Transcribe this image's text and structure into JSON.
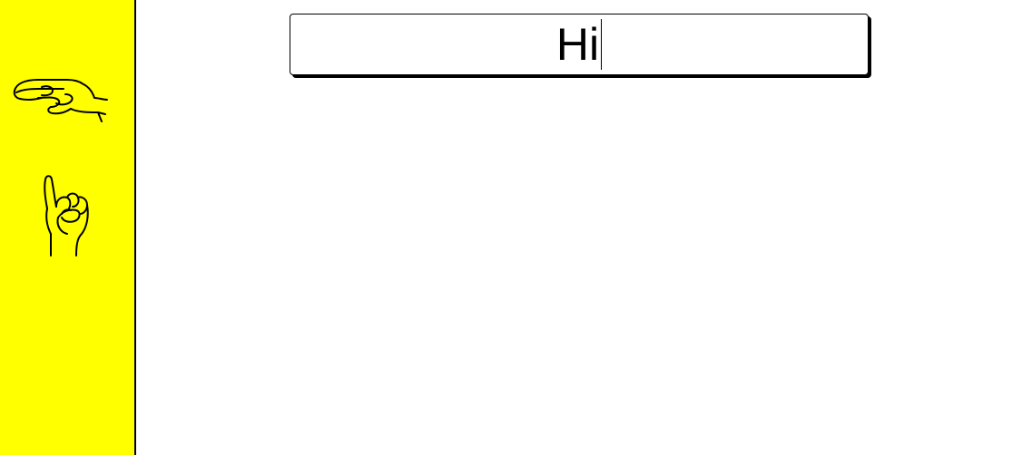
{
  "colors": {
    "sidebar_background": "#ffff00",
    "text": "#000000",
    "page_background": "#ffffff"
  },
  "sidebar": {
    "items": [
      {
        "icon": "asl-letter-h-hand-icon"
      },
      {
        "icon": "asl-letter-i-hand-icon"
      }
    ]
  },
  "text_field": {
    "value": "Hi"
  }
}
